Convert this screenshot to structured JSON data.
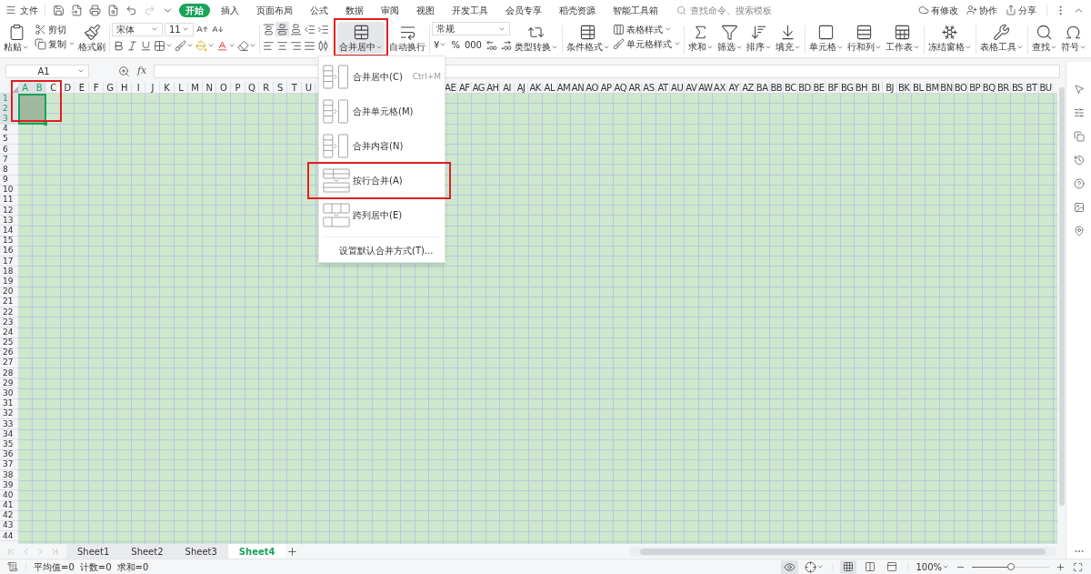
{
  "menu_bar": {
    "file_menu": "文件",
    "tabs": [
      {
        "label": "开始",
        "selected": true
      },
      {
        "label": "插入",
        "selected": false
      },
      {
        "label": "页面布局",
        "selected": false
      },
      {
        "label": "公式",
        "selected": false
      },
      {
        "label": "数据",
        "selected": false
      },
      {
        "label": "审阅",
        "selected": false
      },
      {
        "label": "视图",
        "selected": false
      },
      {
        "label": "开发工具",
        "selected": false
      },
      {
        "label": "会员专享",
        "selected": false
      },
      {
        "label": "稻壳资源",
        "selected": false
      },
      {
        "label": "智能工具箱",
        "selected": false
      }
    ],
    "search": {
      "placeholder": "查找命令、搜索模板"
    },
    "actions": [
      "有修改",
      "协作",
      "分享"
    ]
  },
  "ribbon": {
    "paste": "粘贴",
    "cut": "剪切",
    "copy": "复制",
    "format_painter": "格式刷",
    "font_family": "宋体",
    "font_size": "11",
    "merge_button": {
      "label": "合并居中",
      "selected": true
    },
    "wrap_text": "自动换行",
    "number_format": "常规",
    "number_buttons": [
      "¥",
      "%",
      "000"
    ],
    "type_convert": "类型转换",
    "conditional_format": "条件格式",
    "table_style": "表格样式",
    "cell_style": "单元格样式",
    "tool_buttons": [
      "求和",
      "筛选",
      "排序",
      "填充",
      "单元格",
      "行和列",
      "工作表",
      "冻结窗格",
      "表格工具",
      "查找",
      "符号"
    ]
  },
  "merge_menu": {
    "items": [
      {
        "label": "合并居中(C)",
        "shortcut": "Ctrl+M"
      },
      {
        "label": "合并单元格(M)"
      },
      {
        "label": "合并内容(N)"
      },
      {
        "label": "按行合并(A)"
      },
      {
        "label": "跨列居中(E)"
      }
    ],
    "footer": "设置默认合并方式(T)..."
  },
  "formula_bar": {
    "name_box": "A1",
    "fx": "fx"
  },
  "sheet": {
    "columns_before_menu": [
      {
        "label": "A",
        "selected": true
      },
      {
        "label": "B",
        "selected": true
      },
      {
        "label": "C",
        "selected": false
      },
      {
        "label": "D",
        "selected": false
      },
      {
        "label": "E",
        "selected": false
      },
      {
        "label": "F",
        "selected": false
      },
      {
        "label": "G",
        "selected": false
      },
      {
        "label": "H",
        "selected": false
      },
      {
        "label": "I",
        "selected": false
      },
      {
        "label": "J",
        "selected": false
      },
      {
        "label": "K",
        "selected": false
      },
      {
        "label": "L",
        "selected": false
      },
      {
        "label": "M",
        "selected": false
      },
      {
        "label": "N",
        "selected": false
      },
      {
        "label": "O",
        "selected": false
      },
      {
        "label": "P",
        "selected": false
      },
      {
        "label": "Q",
        "selected": false
      },
      {
        "label": "R",
        "selected": false
      },
      {
        "label": "S",
        "selected": false
      },
      {
        "label": "T",
        "selected": false
      },
      {
        "label": "U",
        "selected": false
      }
    ],
    "columns_after_menu": [
      {
        "label": "AE",
        "selected": false
      },
      {
        "label": "AF",
        "selected": false
      },
      {
        "label": "AG",
        "selected": false
      },
      {
        "label": "AH",
        "selected": false
      },
      {
        "label": "AI",
        "selected": false
      },
      {
        "label": "AJ",
        "selected": false
      },
      {
        "label": "AK",
        "selected": false
      },
      {
        "label": "AL",
        "selected": false
      },
      {
        "label": "AM",
        "selected": false
      },
      {
        "label": "AN",
        "selected": false
      },
      {
        "label": "AO",
        "selected": false
      },
      {
        "label": "AP",
        "selected": false
      },
      {
        "label": "AQ",
        "selected": false
      },
      {
        "label": "AR",
        "selected": false
      },
      {
        "label": "AS",
        "selected": false
      },
      {
        "label": "AT",
        "selected": false
      },
      {
        "label": "AU",
        "selected": false
      },
      {
        "label": "AV",
        "selected": false
      },
      {
        "label": "AW",
        "selected": false
      },
      {
        "label": "AX",
        "selected": false
      },
      {
        "label": "AY",
        "selected": false
      },
      {
        "label": "AZ",
        "selected": false
      },
      {
        "label": "BA",
        "selected": false
      },
      {
        "label": "BB",
        "selected": false
      },
      {
        "label": "BC",
        "selected": false
      },
      {
        "label": "BD",
        "selected": false
      },
      {
        "label": "BE",
        "selected": false
      },
      {
        "label": "BF",
        "selected": false
      },
      {
        "label": "BG",
        "selected": false
      },
      {
        "label": "BH",
        "selected": false
      },
      {
        "label": "BI",
        "selected": false
      },
      {
        "label": "BJ",
        "selected": false
      },
      {
        "label": "BK",
        "selected": false
      },
      {
        "label": "BL",
        "selected": false
      },
      {
        "label": "BM",
        "selected": false
      },
      {
        "label": "BN",
        "selected": false
      },
      {
        "label": "BO",
        "selected": false
      },
      {
        "label": "BP",
        "selected": false
      },
      {
        "label": "BQ",
        "selected": false
      },
      {
        "label": "BR",
        "selected": false
      },
      {
        "label": "BS",
        "selected": false
      },
      {
        "label": "BT",
        "selected": false
      },
      {
        "label": "BU",
        "selected": false
      }
    ],
    "rows": [
      {
        "label": "1",
        "selected": true
      },
      {
        "label": "2",
        "selected": true
      },
      {
        "label": "3",
        "selected": true
      },
      {
        "label": "4",
        "selected": false
      },
      {
        "label": "5",
        "selected": false
      },
      {
        "label": "6",
        "selected": false
      },
      {
        "label": "7",
        "selected": false
      },
      {
        "label": "8",
        "selected": false
      },
      {
        "label": "9",
        "selected": false
      },
      {
        "label": "10",
        "selected": false
      },
      {
        "label": "11",
        "selected": false
      },
      {
        "label": "12",
        "selected": false
      },
      {
        "label": "13",
        "selected": false
      },
      {
        "label": "14",
        "selected": false
      },
      {
        "label": "15",
        "selected": false
      },
      {
        "label": "16",
        "selected": false
      },
      {
        "label": "17",
        "selected": false
      },
      {
        "label": "18",
        "selected": false
      },
      {
        "label": "19",
        "selected": false
      },
      {
        "label": "20",
        "selected": false
      },
      {
        "label": "21",
        "selected": false
      },
      {
        "label": "22",
        "selected": false
      },
      {
        "label": "23",
        "selected": false
      },
      {
        "label": "24",
        "selected": false
      },
      {
        "label": "25",
        "selected": false
      },
      {
        "label": "26",
        "selected": false
      },
      {
        "label": "27",
        "selected": false
      },
      {
        "label": "28",
        "selected": false
      },
      {
        "label": "29",
        "selected": false
      },
      {
        "label": "30",
        "selected": false
      },
      {
        "label": "31",
        "selected": false
      },
      {
        "label": "32",
        "selected": false
      },
      {
        "label": "33",
        "selected": false
      },
      {
        "label": "34",
        "selected": false
      },
      {
        "label": "35",
        "selected": false
      },
      {
        "label": "36",
        "selected": false
      },
      {
        "label": "37",
        "selected": false
      },
      {
        "label": "38",
        "selected": false
      },
      {
        "label": "39",
        "selected": false
      },
      {
        "label": "40",
        "selected": false
      },
      {
        "label": "41",
        "selected": false
      },
      {
        "label": "42",
        "selected": false
      },
      {
        "label": "43",
        "selected": false
      },
      {
        "label": "44",
        "selected": false
      }
    ]
  },
  "sheet_tabs": [
    {
      "label": "Sheet1",
      "selected": false
    },
    {
      "label": "Sheet2",
      "selected": false
    },
    {
      "label": "Sheet3",
      "selected": false
    },
    {
      "label": "Sheet4",
      "selected": true
    }
  ],
  "status_bar": {
    "stats": [
      "平均值=0",
      "计数=0",
      "求和=0"
    ],
    "eye_protection": {
      "on": true
    },
    "view_modes": [
      {
        "selected": true
      },
      {
        "selected": false
      },
      {
        "selected": false
      }
    ],
    "zoom": "100%",
    "zoom_slider": {
      "level": 0.5
    }
  }
}
